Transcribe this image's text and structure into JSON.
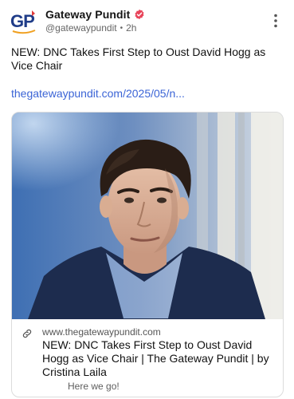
{
  "author": {
    "name": "Gateway Pundit",
    "handle": "@gatewaypundit",
    "time": "2h",
    "separator": "•",
    "avatar_text": "GP"
  },
  "post": {
    "text": "NEW: DNC Takes First Step to Oust David Hogg as Vice Chair",
    "link_text": "thegatewaypundit.com/2025/05/n..."
  },
  "card": {
    "domain": "www.thegatewaypundit.com",
    "title": "NEW: DNC Takes First Step to Oust David Hogg as Vice Chair | The Gateway Pundit | by Cristina Laila",
    "description": "Here we go!"
  },
  "icons": {
    "verified": "verified-badge-icon",
    "more": "more-vertical-icon",
    "link": "link-icon"
  },
  "colors": {
    "verified": "#e8455b",
    "link": "#3b64d6",
    "logo_blue": "#1f3c88",
    "logo_red": "#e03a3a",
    "logo_orange": "#f0a020"
  }
}
